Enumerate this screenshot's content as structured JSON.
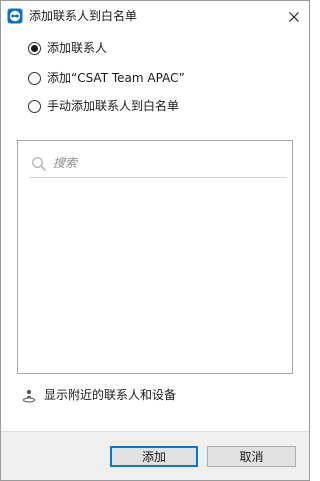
{
  "window": {
    "title": "添加联系人到白名单",
    "app_icon": "teamviewer-logo-icon",
    "close_icon": "close-icon"
  },
  "options": [
    {
      "label": "添加联系人",
      "selected": true
    },
    {
      "label": "添加“CSAT Team APAC”",
      "selected": false
    },
    {
      "label": "手动添加联系人到白名单",
      "selected": false
    }
  ],
  "search": {
    "placeholder": "搜索",
    "value": "",
    "icon": "search-icon"
  },
  "nearby": {
    "label": "显示附近的联系人和设备",
    "icon": "nearby-person-icon"
  },
  "buttons": {
    "add_label": "添加",
    "cancel_label": "取消"
  },
  "colors": {
    "accent": "#0078d7",
    "footer_bg": "#f0f0f0",
    "button_bg": "#e1e1e1"
  }
}
